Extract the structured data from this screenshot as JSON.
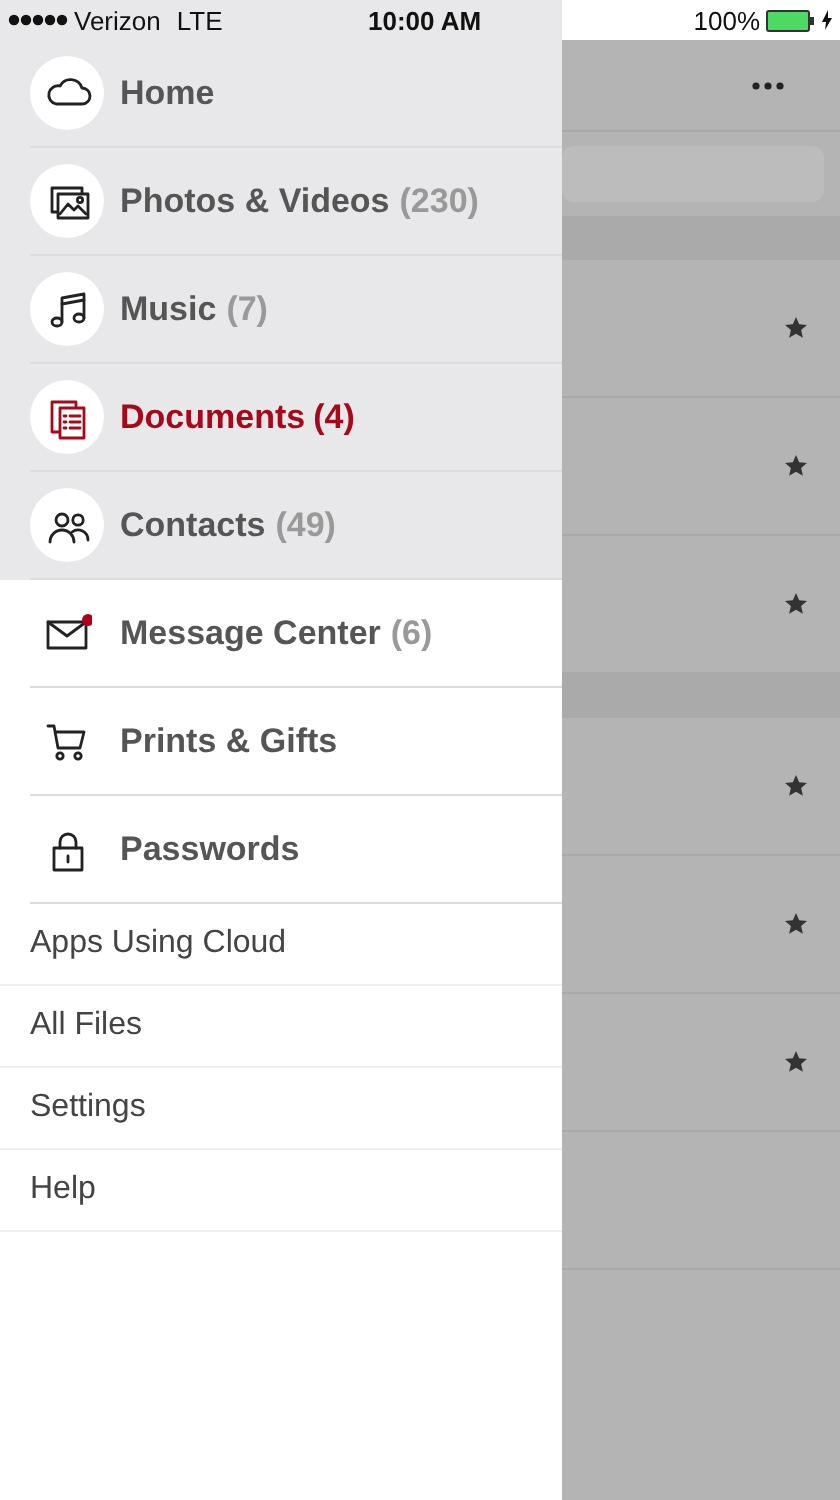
{
  "status_bar": {
    "carrier": "Verizon",
    "network": "LTE",
    "time": "10:00 AM",
    "battery": "100%"
  },
  "menu": [
    {
      "kind": "circle",
      "label": "Home",
      "selected": false
    },
    {
      "kind": "circle",
      "label": "Photos & Videos",
      "count": "(230)",
      "selected": false
    },
    {
      "kind": "circle",
      "label": "Music",
      "count": "(7)",
      "selected": false
    },
    {
      "kind": "circle",
      "label": "Documents",
      "count": "(4)",
      "selected": true
    },
    {
      "kind": "circle",
      "label": "Contacts",
      "count": "(49)",
      "selected": false
    },
    {
      "kind": "icon",
      "label": "Message Center",
      "count": "(6)",
      "unread": true,
      "selected": false
    },
    {
      "kind": "icon",
      "label": "Prints & Gifts",
      "selected": false
    },
    {
      "kind": "icon",
      "label": "Passwords",
      "selected": false
    },
    {
      "kind": "text",
      "label": "Apps Using Cloud",
      "selected": false
    },
    {
      "kind": "text",
      "label": "All Files",
      "selected": false
    },
    {
      "kind": "text",
      "label": "Settings",
      "selected": false
    },
    {
      "kind": "text",
      "label": "Help",
      "selected": false
    }
  ],
  "background": {
    "sections": [
      {
        "rows": [
          {
            "starred": true
          },
          {
            "starred": true
          },
          {
            "starred": true
          }
        ]
      },
      {
        "rows": [
          {
            "starred": true
          },
          {
            "starred": true
          },
          {
            "starred": true
          },
          {
            "starred": false
          }
        ]
      }
    ]
  }
}
